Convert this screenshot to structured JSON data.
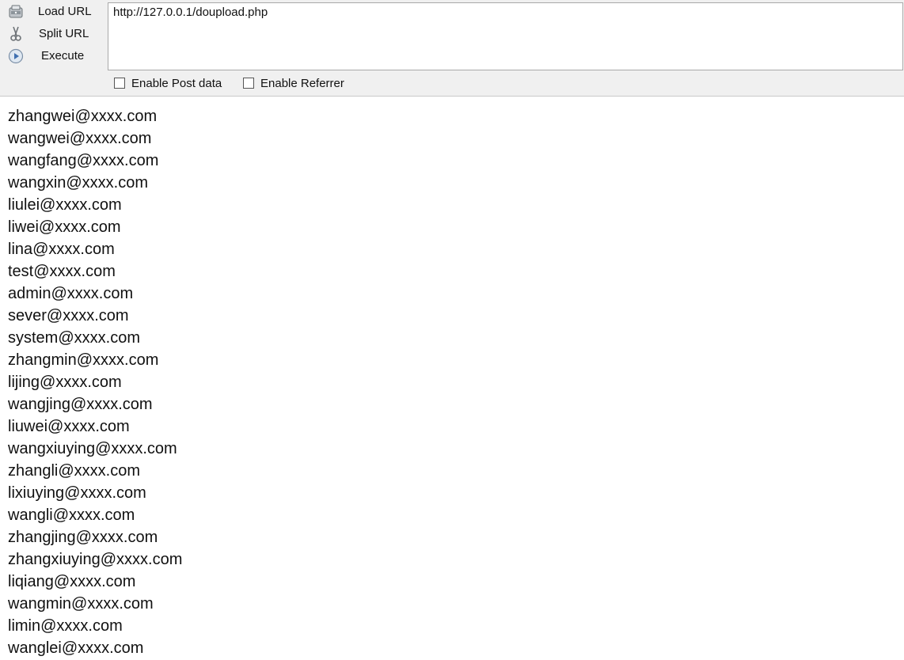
{
  "toolbar": {
    "load_url_label": "Load URL",
    "split_url_label": "Split URL",
    "execute_label": "Execute",
    "url_value": "http://127.0.0.1/doupload.php",
    "enable_post_label": "Enable Post data",
    "enable_referrer_label": "Enable Referrer",
    "enable_post_checked": false,
    "enable_referrer_checked": false
  },
  "icons": {
    "load": "load-url-icon",
    "split": "scissors-icon",
    "execute": "play-icon"
  },
  "results": [
    "zhangwei@xxxx.com",
    "wangwei@xxxx.com",
    "wangfang@xxxx.com",
    "wangxin@xxxx.com",
    "liulei@xxxx.com",
    "liwei@xxxx.com",
    "lina@xxxx.com",
    "test@xxxx.com",
    "admin@xxxx.com",
    "sever@xxxx.com",
    "system@xxxx.com",
    "zhangmin@xxxx.com",
    "lijing@xxxx.com",
    "wangjing@xxxx.com",
    "liuwei@xxxx.com",
    "wangxiuying@xxxx.com",
    "zhangli@xxxx.com",
    "lixiuying@xxxx.com",
    "wangli@xxxx.com",
    "zhangjing@xxxx.com",
    "zhangxiuying@xxxx.com",
    "liqiang@xxxx.com",
    "wangmin@xxxx.com",
    "limin@xxxx.com",
    "wanglei@xxxx.com"
  ]
}
